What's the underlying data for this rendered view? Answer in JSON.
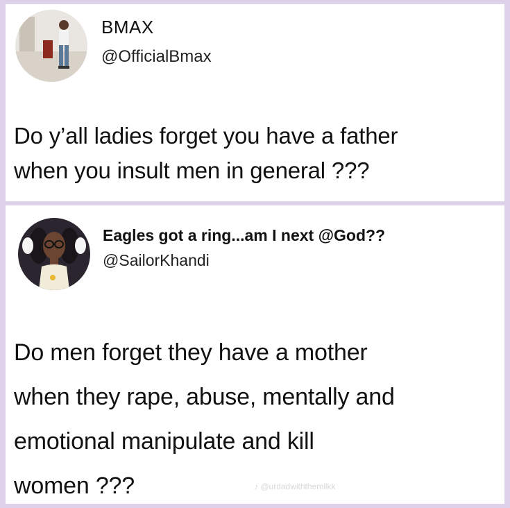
{
  "tweets": [
    {
      "display_name": "BMAX",
      "handle": "@OfficialBmax",
      "text_lines": [
        "Do y’all ladies forget you have a father",
        "when you insult men in general ???"
      ],
      "avatar_icon": "profile-photo-man-standing"
    },
    {
      "display_name": "Eagles got a ring...am I next @God??",
      "handle": "@SailorKhandi",
      "text_lines": [
        "Do men forget they have a mother",
        "when they rape, abuse, mentally and",
        "emotional manipulate and kill",
        "women ???"
      ],
      "avatar_icon": "profile-photo-woman-glasses"
    }
  ],
  "watermark": "♪ @urdadwiththemilkk"
}
